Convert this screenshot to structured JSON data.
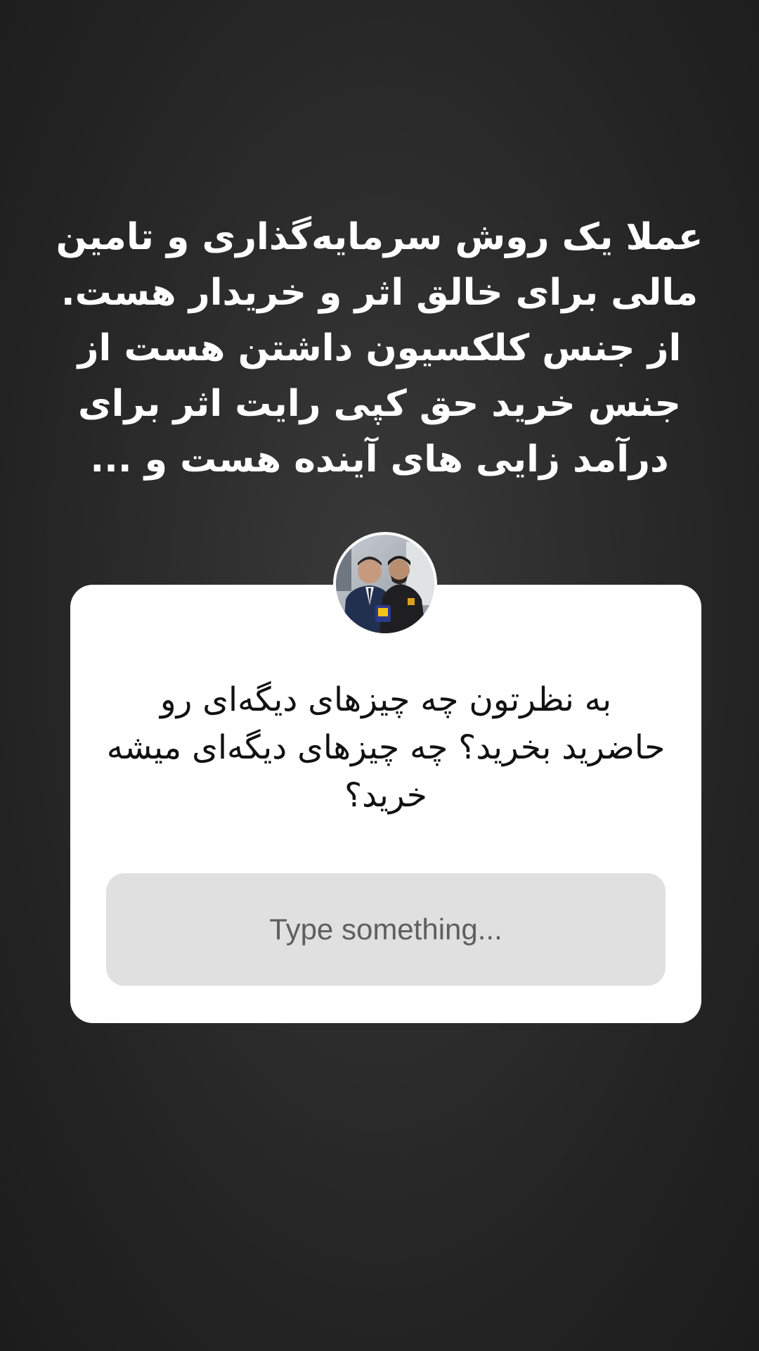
{
  "story": {
    "text": "عملا یک روش سرمایه‌گذاری و تامین مالی برای خالق اثر و خریدار هست. از جنس کلکسیون داشتن هست از جنس خرید حق کپی رایت اثر برای درآمد زایی های آینده هست و ..."
  },
  "question_card": {
    "question": "به نظرتون چه چیزهای دیگه‌ای رو حاضرید بخرید؟ چه چیزهای دیگه‌ای میشه خرید؟",
    "input_placeholder": "Type something..."
  },
  "colors": {
    "background": "#2e2e2e",
    "card": "#ffffff",
    "input": "#e0e0e0"
  }
}
